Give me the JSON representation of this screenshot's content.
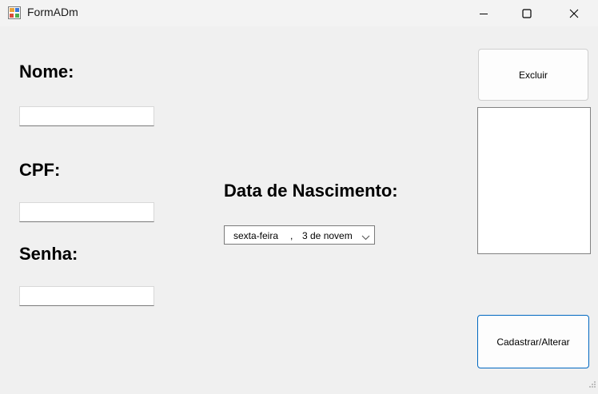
{
  "window": {
    "title": "FormADm",
    "controls": {
      "minimize": "minimize-icon",
      "maximize": "maximize-icon",
      "close": "close-icon"
    }
  },
  "form": {
    "nome_label": "Nome:",
    "nome_value": "",
    "cpf_label": "CPF:",
    "cpf_value": "",
    "senha_label": "Senha:",
    "senha_value": "",
    "data_label": "Data de Nascimento:",
    "data_day": "sexta-feira",
    "data_sep": ",",
    "data_value": "3 de novem"
  },
  "buttons": {
    "excluir": "Excluir",
    "cadastrar": "Cadastrar/Alterar"
  },
  "listbox": {
    "items": []
  },
  "colors": {
    "accent": "#0067c0",
    "background": "#f0f0f0",
    "titlebar": "#f3f3f3"
  }
}
